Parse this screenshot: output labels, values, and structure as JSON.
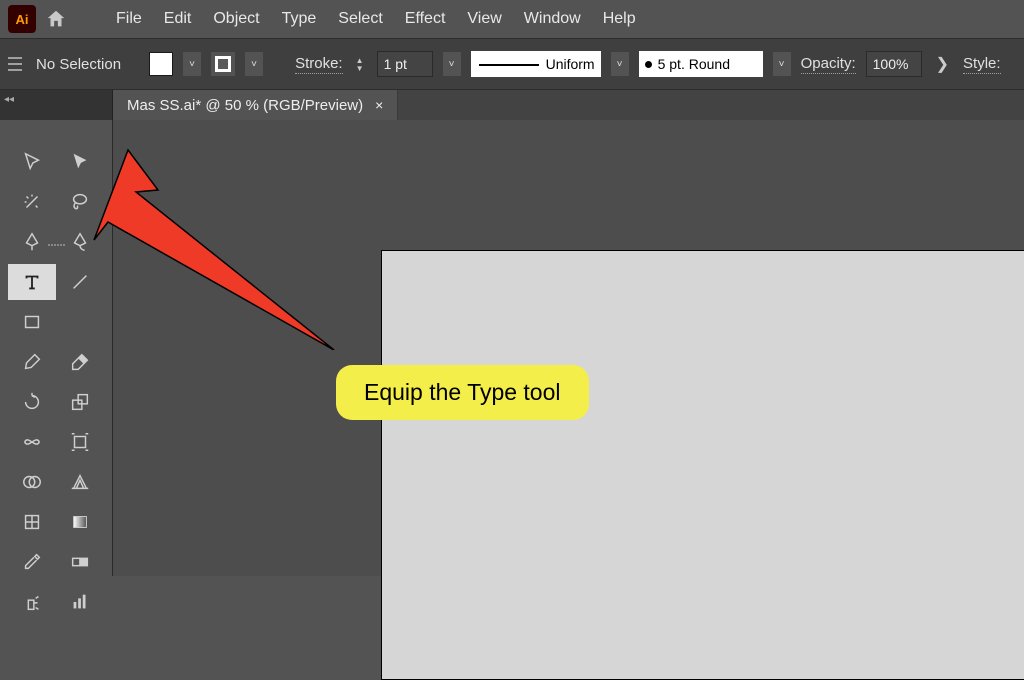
{
  "app": {
    "logo_text": "Ai"
  },
  "menu": {
    "file": "File",
    "edit": "Edit",
    "object": "Object",
    "type": "Type",
    "select": "Select",
    "effect": "Effect",
    "view": "View",
    "window": "Window",
    "help": "Help"
  },
  "controlbar": {
    "selection_status": "No Selection",
    "stroke_label": "Stroke:",
    "stroke_value": "1 pt",
    "profile_label": "Uniform",
    "brush_label": "5 pt. Round",
    "opacity_label": "Opacity:",
    "opacity_value": "100%",
    "style_label": "Style:"
  },
  "tab": {
    "title": "Mas SS.ai* @ 50 % (RGB/Preview)",
    "close": "×"
  },
  "callout_text": "Equip the Type tool",
  "tools": {
    "selection": "selection-tool",
    "direct_selection": "direct-selection-tool",
    "magic_wand": "magic-wand-tool",
    "lasso": "lasso-tool",
    "pen": "pen-tool",
    "curvature": "curvature-tool",
    "type": "type-tool",
    "line": "line-segment-tool",
    "rectangle": "rectangle-tool",
    "paintbrush": "paintbrush-tool",
    "eraser": "eraser-tool",
    "rotate": "rotate-tool",
    "scale": "scale-tool",
    "width": "width-tool",
    "free_transform": "free-transform-tool",
    "shape_builder": "shape-builder-tool",
    "perspective": "perspective-grid-tool",
    "mesh": "mesh-tool",
    "gradient": "gradient-tool",
    "eyedropper": "eyedropper-tool",
    "blend": "blend-tool",
    "symbol_sprayer": "symbol-sprayer-tool",
    "column_graph": "column-graph-tool"
  }
}
